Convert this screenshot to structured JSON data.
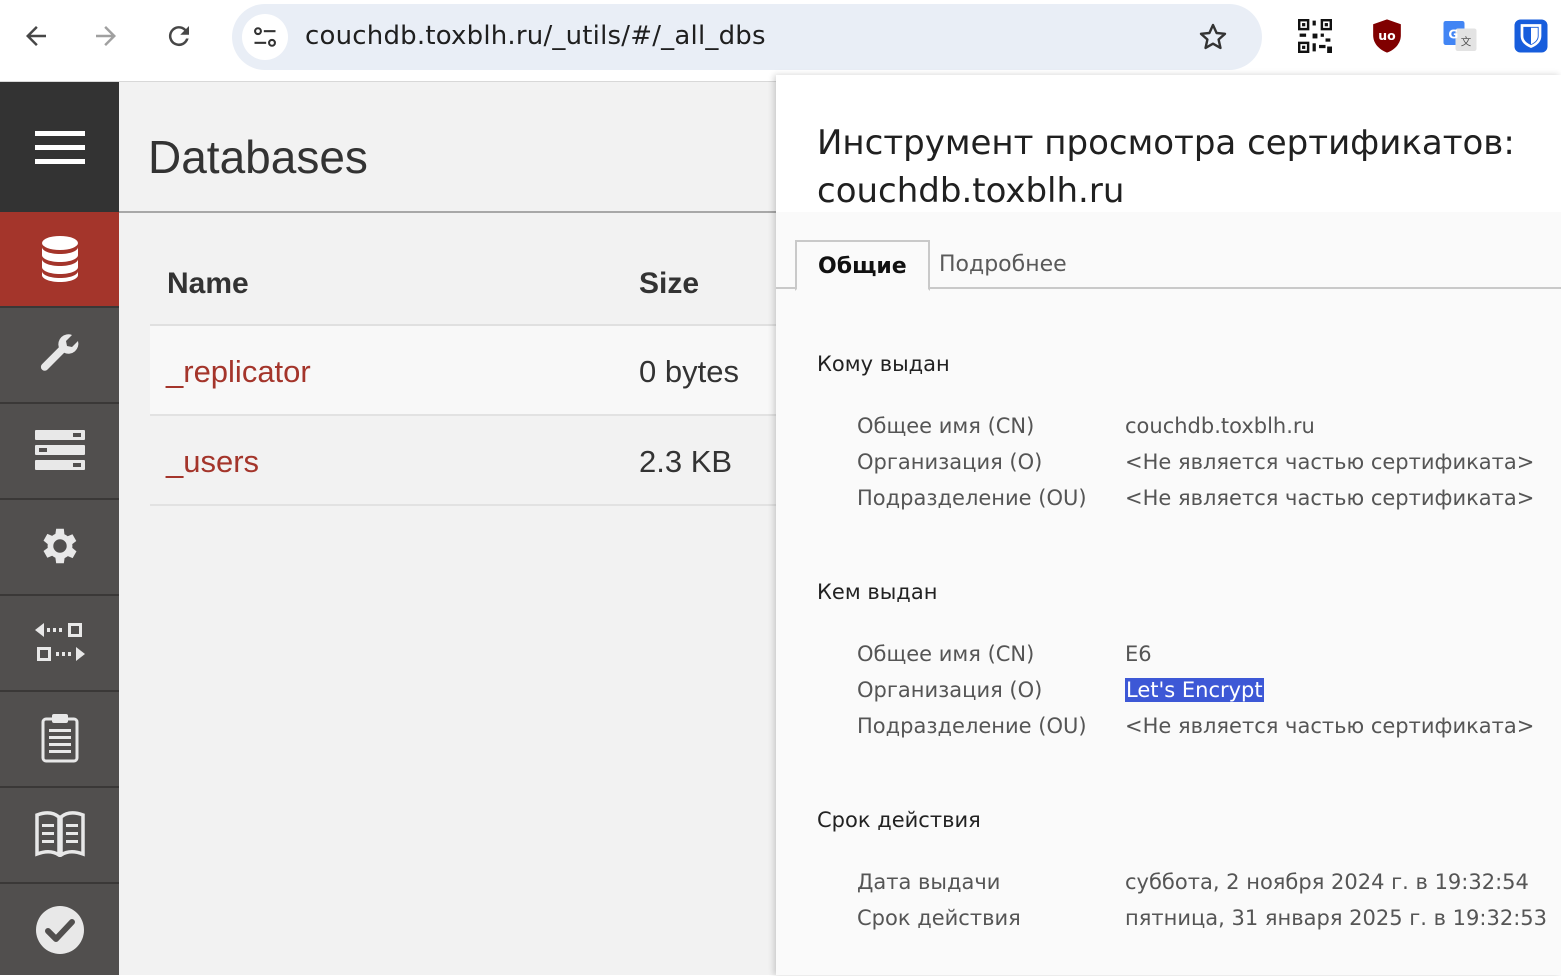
{
  "browser": {
    "url": "couchdb.toxblh.ru/_utils/#/_all_dbs"
  },
  "couch": {
    "page_title": "Databases",
    "table": {
      "headers": [
        "Name",
        "Size"
      ],
      "rows": [
        {
          "name": "_replicator",
          "size": "0 bytes"
        },
        {
          "name": "_users",
          "size": "2.3 KB"
        }
      ]
    },
    "sidebar": [
      "menu-icon",
      "databases-icon",
      "setup-icon",
      "active-tasks-icon",
      "config-icon",
      "replication-icon",
      "logs-icon",
      "documentation-icon",
      "verify-icon"
    ]
  },
  "cert": {
    "title_line1": "Инструмент просмотра сертификатов:",
    "title_line2": "couchdb.toxblh.ru",
    "tabs": [
      "Общие",
      "Подробнее"
    ],
    "issued_to": {
      "heading": "Кому выдан",
      "rows": [
        {
          "label": "Общее имя (CN)",
          "value": "couchdb.toxblh.ru"
        },
        {
          "label": "Организация (O)",
          "value": "<Не является частью сертификата>"
        },
        {
          "label": "Подразделение (OU)",
          "value": "<Не является частью сертификата>"
        }
      ]
    },
    "issued_by": {
      "heading": "Кем выдан",
      "rows": [
        {
          "label": "Общее имя (CN)",
          "value": "E6"
        },
        {
          "label": "Организация (O)",
          "value": "Let's Encrypt"
        },
        {
          "label": "Подразделение (OU)",
          "value": "<Не является частью сертификата>"
        }
      ]
    },
    "validity": {
      "heading": "Срок действия",
      "rows": [
        {
          "label": "Дата выдачи",
          "value": "суббота, 2 ноября 2024 г. в 19:32:54"
        },
        {
          "label": "Срок действия",
          "value": "пятница, 31 января 2025 г. в 19:32:53"
        }
      ]
    }
  },
  "colors": {
    "couch_red": "#a4352b",
    "selection": "#3d58d6"
  }
}
